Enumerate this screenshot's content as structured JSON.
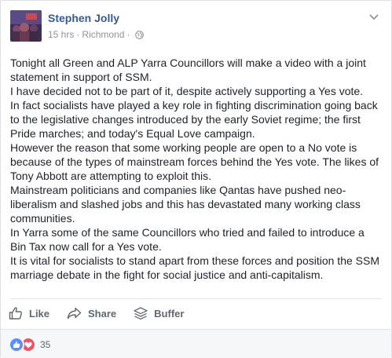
{
  "post": {
    "author": "Stephen Jolly",
    "time": "15 hrs",
    "location": "Richmond",
    "separator": "·",
    "paragraphs": [
      "Tonight all Green and ALP Yarra Councillors will make a video with a joint statement in support of SSM.",
      "I have decided not to be part of it, despite actively supporting a Yes vote.",
      "In fact socialists have played a key role in fighting discrimination going back to the legislative changes introduced by the early Soviet regime; the first Pride marches; and today's Equal Love campaign.",
      "However the reason that some working people are open to a No vote is because of the types of mainstream forces behind the Yes vote. The likes of Tony Abbott are attempting to exploit this.",
      "Mainstream politicians and companies like Qantas have pushed neo-liberalism and slashed jobs and this has devastated many working class communities.",
      "In Yarra some of the same Councillors who tried and failed to introduce a Bin Tax now call for a Yes vote.",
      "It is vital for socialists to stand apart from these forces and position the SSM marriage debate in the fight for social justice and anti-capitalism."
    ]
  },
  "actions": {
    "like": "Like",
    "share": "Share",
    "buffer": "Buffer"
  },
  "reactions": {
    "count": "35"
  },
  "colors": {
    "author_link": "#365899",
    "like_reaction": "#5890ff",
    "love_reaction": "#f25268"
  },
  "icons": [
    "avatar-photo",
    "chevron-down-icon",
    "globe-icon",
    "thumbs-up-icon",
    "share-arrow-icon",
    "buffer-stack-icon",
    "like-reaction-icon",
    "love-reaction-icon"
  ]
}
